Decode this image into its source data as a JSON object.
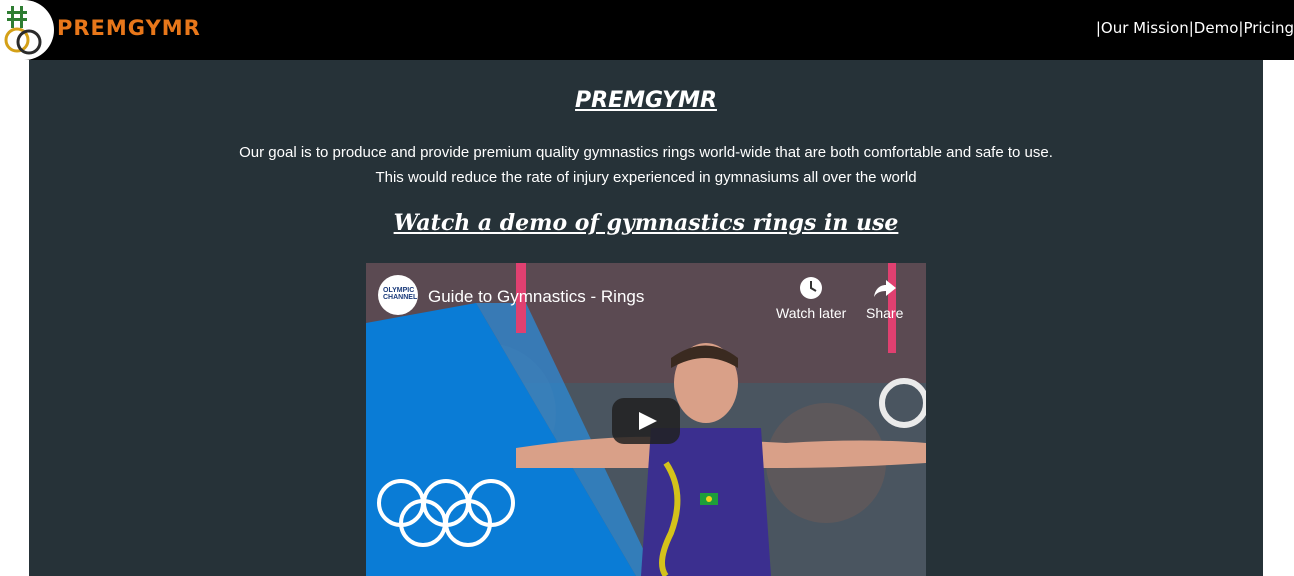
{
  "header": {
    "brand": "PREMGYMR",
    "nav": {
      "sep": "|",
      "items": [
        "Our Mission",
        "Demo",
        "Pricing"
      ]
    }
  },
  "main": {
    "title": "PREMGYMR",
    "mission_line1": "Our goal is to produce and provide premium quality gymnastics rings world-wide that are both comfortable and safe to use.",
    "mission_line2": "This would reduce the rate of injury experienced in gymnasiums all over the world",
    "demo_heading": "Watch a demo of gymnastics rings in use"
  },
  "video": {
    "channel_badge": "OLYMPIC CHANNEL",
    "title": "Guide to Gymnastics - Rings",
    "watch_later": "Watch later",
    "share": "Share"
  },
  "colors": {
    "header_bg": "#000000",
    "brand": "#e8771a",
    "panel_bg": "#263238",
    "olympic_blue": "#0a7cd6"
  }
}
